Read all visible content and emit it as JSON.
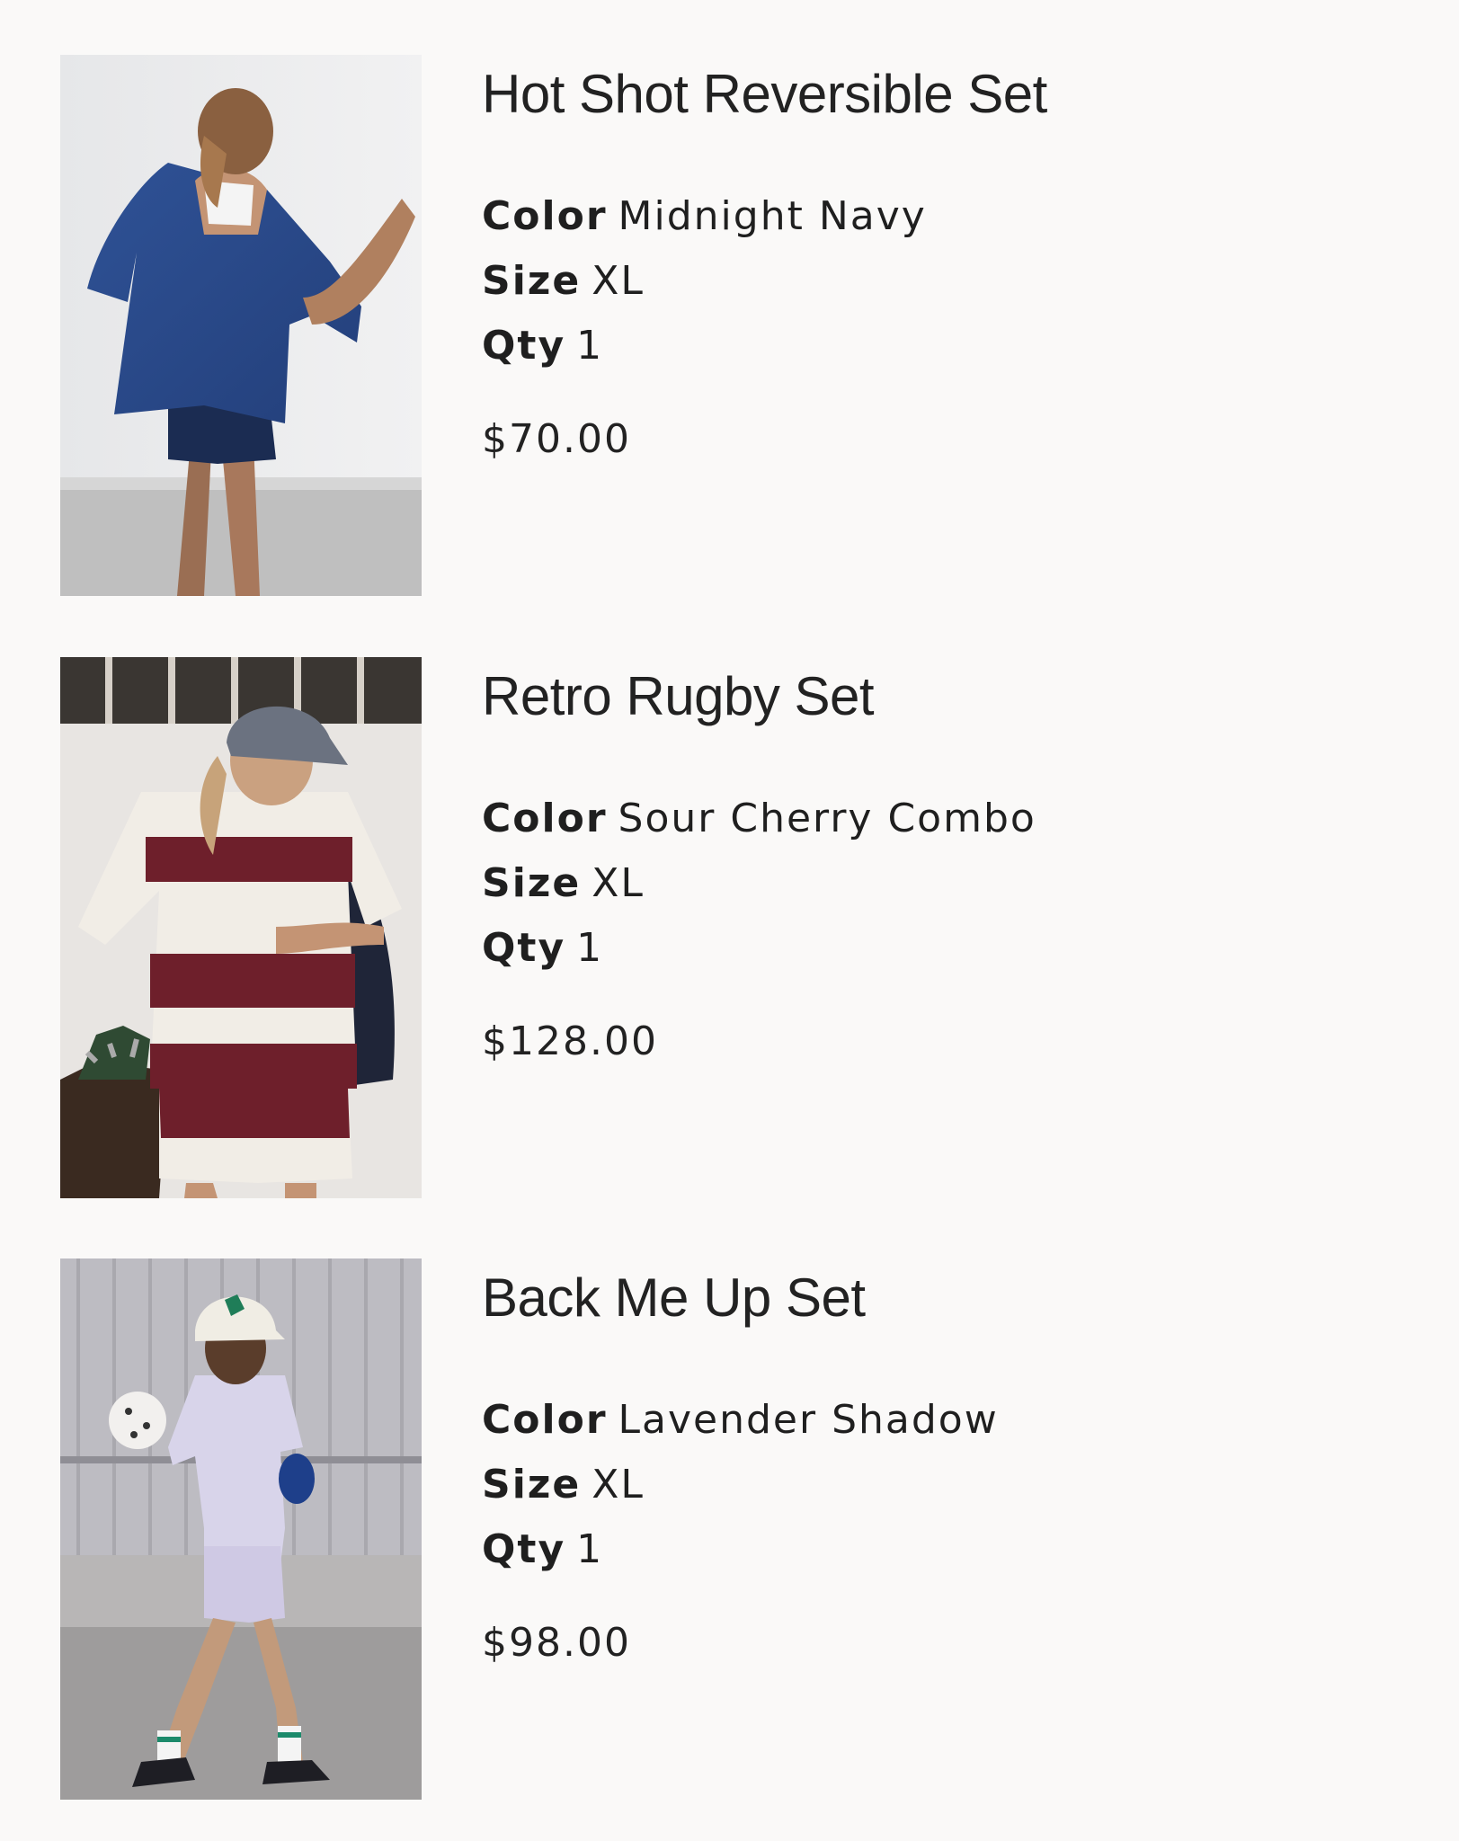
{
  "cart": {
    "labels": {
      "color": "Color",
      "size": "Size",
      "qty": "Qty"
    },
    "items": [
      {
        "title": "Hot Shot Reversible Set",
        "color": "Midnight Navy",
        "size": "XL",
        "qty": "1",
        "price": "$70.00",
        "image_alt": "Hot Shot Reversible Set in Midnight Navy"
      },
      {
        "title": "Retro Rugby Set",
        "color": "Sour Cherry Combo",
        "size": "XL",
        "qty": "1",
        "price": "$128.00",
        "image_alt": "Retro Rugby Set in Sour Cherry Combo"
      },
      {
        "title": "Back Me Up Set",
        "color": "Lavender Shadow",
        "size": "XL",
        "qty": "1",
        "price": "$98.00",
        "image_alt": "Back Me Up Set in Lavender Shadow"
      }
    ]
  },
  "colors": {
    "background": "#faf9f8",
    "text": "#1f1f1f",
    "midnight_navy": "#2a4a8c",
    "sour_cherry": "#6e1f2b",
    "lavender_shadow": "#d8d4ea"
  }
}
